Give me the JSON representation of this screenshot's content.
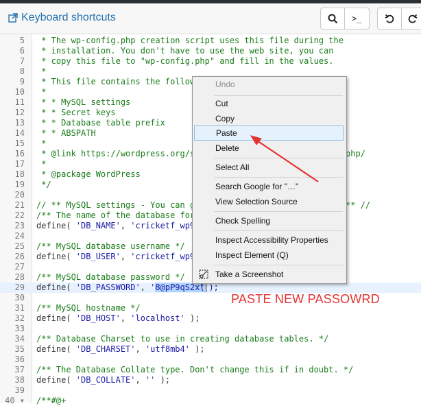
{
  "toolbar": {
    "shortcuts_label": "Keyboard shortcuts",
    "search_icon": "search-icon",
    "terminal_icon": "terminal-icon",
    "terminal_glyph": ">_",
    "undo_icon": "undo-icon",
    "redo_icon": "redo-icon"
  },
  "code_lines": [
    {
      "n": "5",
      "t": " * The wp-config.php creation script uses this file during the"
    },
    {
      "n": "6",
      "t": " * installation. You don't have to use the web site, you can"
    },
    {
      "n": "7",
      "t": " * copy this file to \"wp-config.php\" and fill in the values."
    },
    {
      "n": "8",
      "t": " *"
    },
    {
      "n": "9",
      "t": " * This file contains the followi"
    },
    {
      "n": "10",
      "t": " *"
    },
    {
      "n": "11",
      "t": " * * MySQL settings"
    },
    {
      "n": "12",
      "t": " * * Secret keys"
    },
    {
      "n": "13",
      "t": " * * Database table prefix"
    },
    {
      "n": "14",
      "t": " * * ABSPATH"
    },
    {
      "n": "15",
      "t": " *"
    },
    {
      "n": "16",
      "t": " * @link https://wordpress.org/su",
      "tail": "php/"
    },
    {
      "n": "17",
      "t": " *"
    },
    {
      "n": "18",
      "t": " * @package WordPress"
    },
    {
      "n": "19",
      "t": " */"
    },
    {
      "n": "20",
      "t": ""
    },
    {
      "n": "21",
      "t": "// ** MySQL settings - You can ge",
      "tail": "** //"
    },
    {
      "n": "22",
      "t": "/** The name of the database for"
    },
    {
      "n": "23",
      "t": "define( 'DB_NAME', 'cricketf_wp94"
    },
    {
      "n": "24",
      "t": ""
    },
    {
      "n": "25",
      "t": "/** MySQL database username */"
    },
    {
      "n": "26",
      "t": "define( 'DB_USER', 'cricketf_wp94"
    },
    {
      "n": "27",
      "t": ""
    },
    {
      "n": "28",
      "t": "/** MySQL database password */"
    },
    {
      "n": "29",
      "t": "define( 'DB_PASSWORD', '",
      "selected": "8@pP9qS2x(",
      "tail": "' );"
    },
    {
      "n": "30",
      "t": ""
    },
    {
      "n": "31",
      "t": "/** MySQL hostname */"
    },
    {
      "n": "32",
      "t": "define( 'DB_HOST', 'localhost' );"
    },
    {
      "n": "33",
      "t": ""
    },
    {
      "n": "34",
      "t": "/** Database Charset to use in creating database tables. */"
    },
    {
      "n": "35",
      "t": "define( 'DB_CHARSET', 'utf8mb4' );"
    },
    {
      "n": "36",
      "t": ""
    },
    {
      "n": "37",
      "t": "/** The Database Collate type. Don't change this if in doubt. */"
    },
    {
      "n": "38",
      "t": "define( 'DB_COLLATE', '' );"
    },
    {
      "n": "39",
      "t": ""
    },
    {
      "n": "40 ▾",
      "t": "/**#@+"
    }
  ],
  "context_menu": {
    "undo": "Undo",
    "cut": "Cut",
    "copy": "Copy",
    "paste": "Paste",
    "delete": "Delete",
    "select_all": "Select All",
    "search_google": "Search Google for \"…\"",
    "view_selection_source": "View Selection Source",
    "check_spelling": "Check Spelling",
    "inspect_accessibility": "Inspect Accessibility Properties",
    "inspect_element": "Inspect Element (Q)",
    "take_screenshot": "Take a Screenshot"
  },
  "annotation": {
    "text": "PASTE NEW PASSOWRD",
    "color": "#e53333"
  }
}
